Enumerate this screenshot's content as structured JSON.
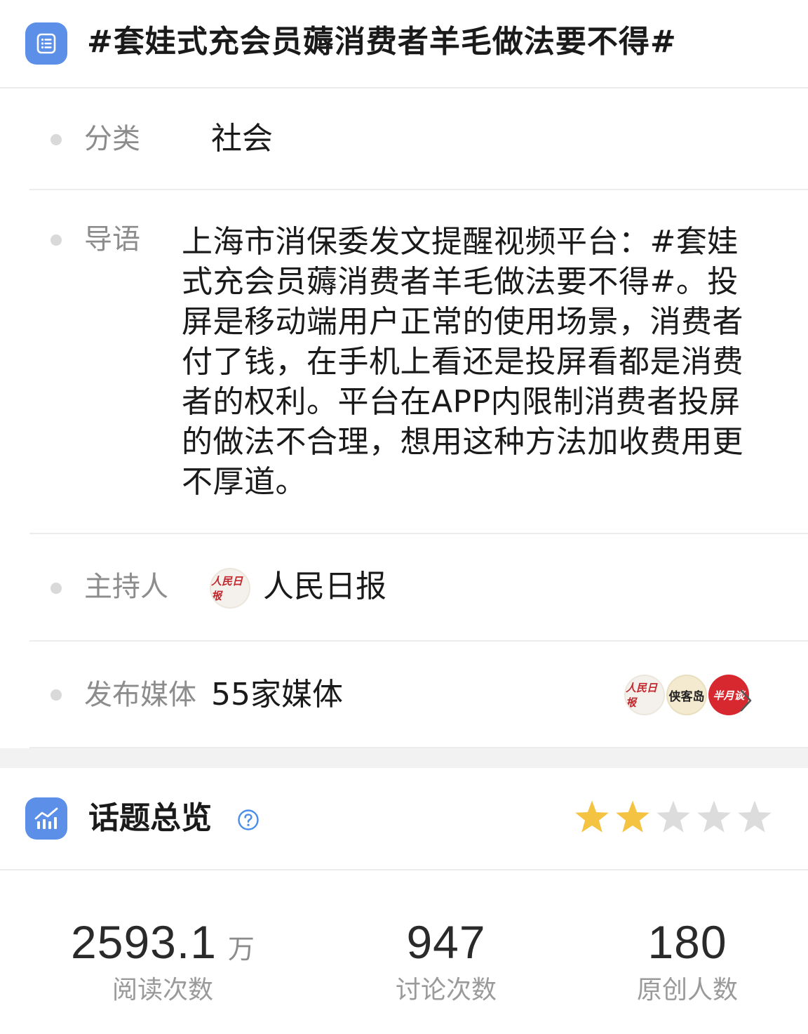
{
  "header": {
    "icon": "list-document-icon",
    "title": "#套娃式充会员薅消费者羊毛做法要不得#"
  },
  "info": {
    "category": {
      "label": "分类",
      "value": "社会"
    },
    "intro": {
      "label": "导语",
      "text": "上海市消保委发文提醒视频平台：#套娃式充会员薅消费者羊毛做法要不得#。投屏是移动端用户正常的使用场景，消费者付了钱，在手机上看还是投屏看都是消费者的权利。平台在APP内限制消费者投屏的做法不合理，想用这种方法加收费用更不厚道。"
    },
    "host": {
      "label": "主持人",
      "name": "人民日报",
      "avatar_text": "人民日报"
    },
    "media": {
      "label": "发布媒体",
      "value": "55家媒体",
      "avatars": [
        {
          "name": "人民日报",
          "text": "人民日报"
        },
        {
          "name": "侠客岛",
          "text": "侠客岛"
        },
        {
          "name": "半月谈",
          "text": "半月谈"
        }
      ],
      "chevron_icon": "chevron-right-icon"
    }
  },
  "overview": {
    "icon": "stats-chart-icon",
    "title": "话题总览",
    "help_icon": "question-circle-icon",
    "rating": {
      "value": 2,
      "max": 5,
      "filled_color": "#f5c342",
      "empty_color": "#dcdcdc"
    },
    "stats": [
      {
        "value": "2593.1",
        "unit": "万",
        "label": "阅读次数"
      },
      {
        "value": "947",
        "unit": "",
        "label": "讨论次数"
      },
      {
        "value": "180",
        "unit": "",
        "label": "原创人数"
      }
    ]
  },
  "colors": {
    "accent": "#5b8fe8",
    "divider": "#ececec",
    "label_gray": "#8c8c8c",
    "band_gray": "#f2f2f2"
  }
}
